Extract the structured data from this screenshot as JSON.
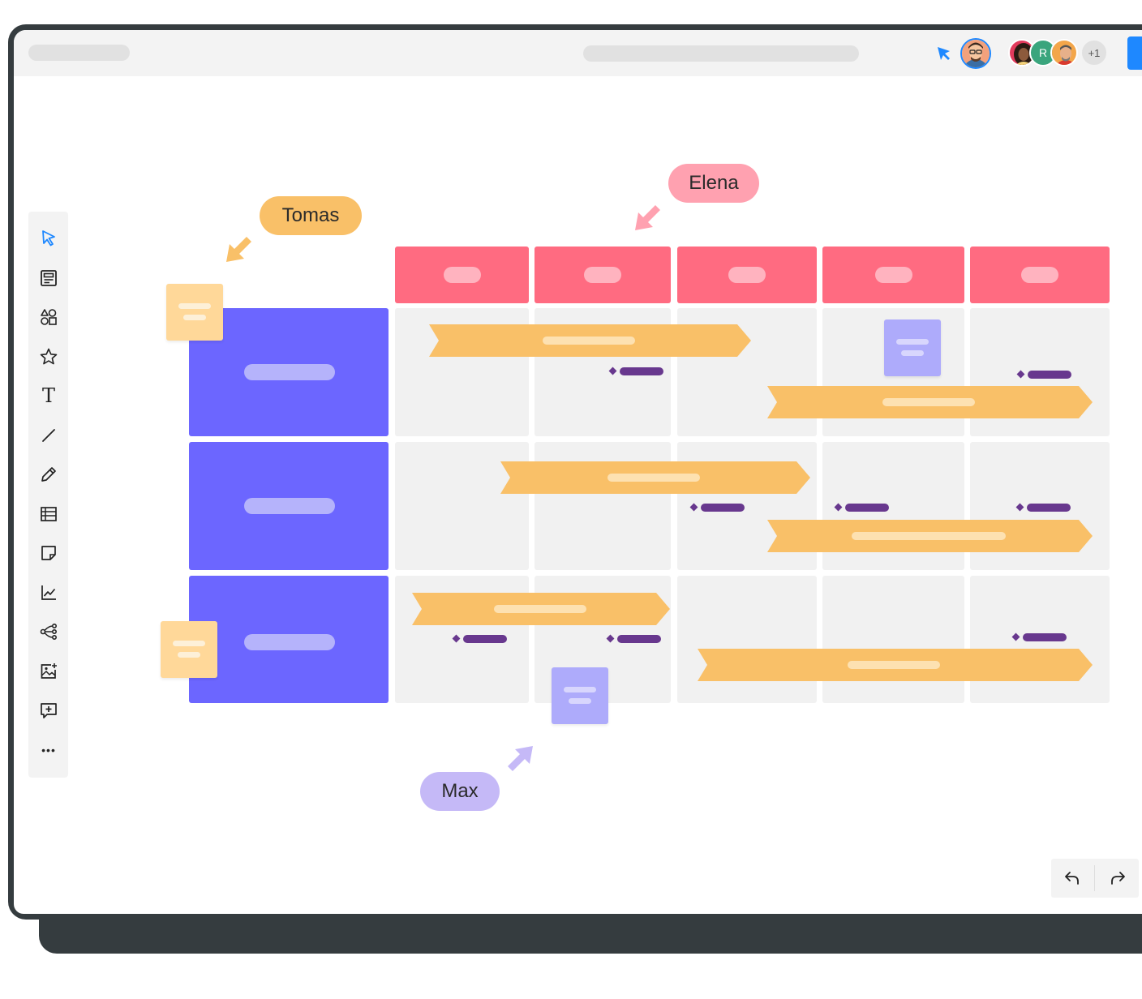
{
  "colors": {
    "frame": "#353c3f",
    "topbar": "#f3f3f3",
    "header_block": "#ff6b81",
    "row_block": "#6c66ff",
    "cell": "#f1f1f1",
    "bar": "#f9c068",
    "milestone": "#68388e",
    "sticky_yellow": "#ffd899",
    "sticky_purple": "#aeabfb",
    "accent_blue": "#1e88ff"
  },
  "topbar": {
    "cursor_icon": "pointer-arrow-icon",
    "collaborators": {
      "initial_badge": "R",
      "more_count": "+1"
    }
  },
  "toolbar": {
    "tools": [
      "select-icon",
      "template-icon",
      "shapes-icon",
      "star-icon",
      "text-icon",
      "line-icon",
      "pen-icon",
      "table-icon",
      "sticky-note-icon",
      "chart-icon",
      "mindmap-icon",
      "image-add-icon",
      "comment-add-icon",
      "more-icon"
    ],
    "text_tool_glyph": "T",
    "more_glyph": "•••"
  },
  "cursors": {
    "tomas": {
      "name": "Tomas",
      "color": "#f9c068"
    },
    "elena": {
      "name": "Elena",
      "color": "#ffa1b0"
    },
    "max": {
      "name": "Max",
      "color": "#c5b9f7"
    }
  },
  "undo_redo": {
    "undo_icon": "undo-icon",
    "redo_icon": "redo-icon"
  }
}
